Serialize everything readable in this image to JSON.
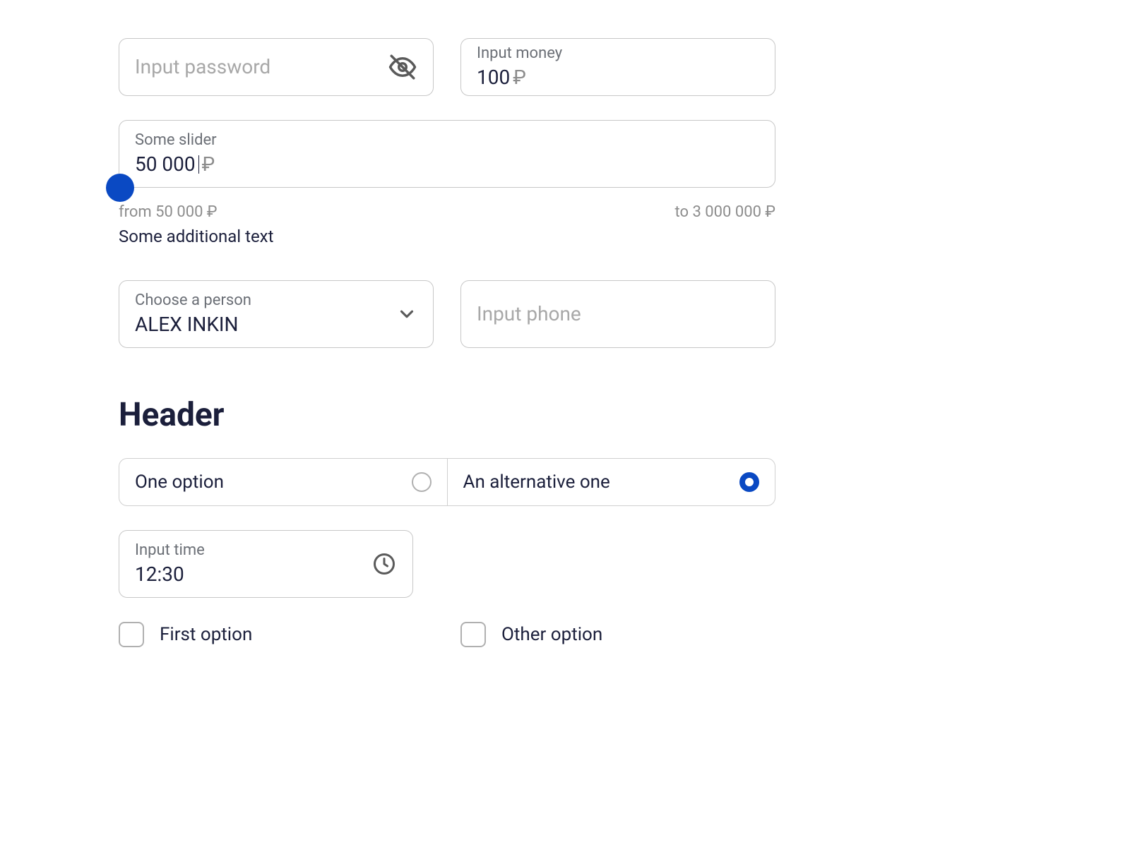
{
  "password": {
    "placeholder": "Input password"
  },
  "money": {
    "label": "Input money",
    "value": "100",
    "currency": "₽"
  },
  "slider": {
    "label": "Some slider",
    "value": "50 000",
    "currency": "₽",
    "from": "from 50 000 ₽",
    "to": "to 3 000 000 ₽",
    "hint": "Some additional text"
  },
  "person": {
    "label": "Choose a person",
    "value": "ALEX INKIN"
  },
  "phone": {
    "placeholder": "Input phone"
  },
  "header": "Header",
  "radio": {
    "option1": "One option",
    "option2": "An alternative one"
  },
  "time": {
    "label": "Input time",
    "value": "12:30"
  },
  "checks": {
    "first": "First option",
    "other": "Other option"
  }
}
